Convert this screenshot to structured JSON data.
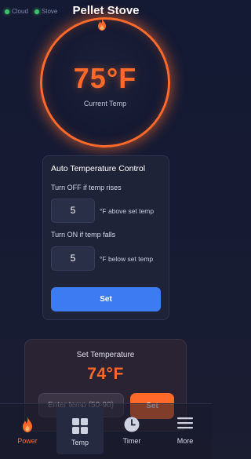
{
  "status": {
    "cloud_label": "Cloud",
    "stove_label": "Stove",
    "online_color": "#3cc46a"
  },
  "header": {
    "title": "Pellet Stove"
  },
  "gauge": {
    "current_temp": "75°F",
    "current_label": "Current Temp",
    "ring_color": "#ff6a2b"
  },
  "auto_control": {
    "title": "Auto Temperature Control",
    "off_rule": {
      "label": "Turn OFF if temp rises",
      "value": "5",
      "unit": "°F above set temp"
    },
    "on_rule": {
      "label": "Turn ON if temp falls",
      "value": "5",
      "unit": "°F below set temp"
    },
    "set_label": "Set",
    "button_color": "#3d7bf2"
  },
  "set_temperature": {
    "title": "Set Temperature",
    "value": "74°F",
    "placeholder": "Enter temp (50-90)",
    "set_label": "Set",
    "button_color": "#ff6a2b"
  },
  "nav": {
    "items": [
      {
        "label": "Power",
        "icon": "flame-icon",
        "active": true
      },
      {
        "label": "Temp",
        "icon": "grid-icon",
        "active": false
      },
      {
        "label": "Timer",
        "icon": "clock-icon",
        "active": false
      },
      {
        "label": "More",
        "icon": "menu-icon",
        "active": false
      }
    ]
  }
}
